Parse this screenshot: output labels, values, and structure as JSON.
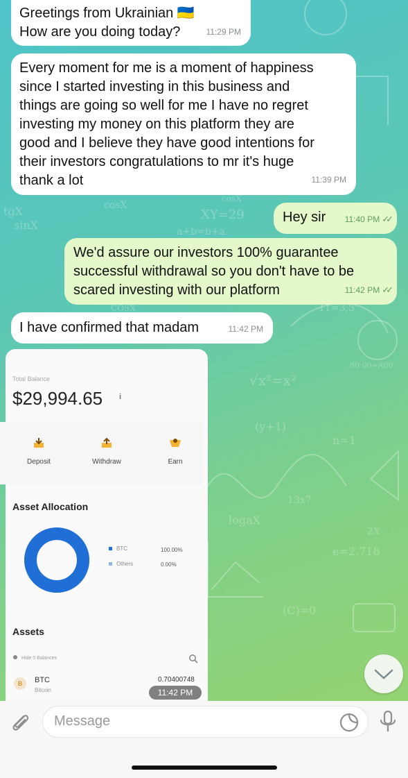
{
  "chat": {
    "messages": [
      {
        "direction": "in",
        "lines": "Greetings from Ukrainian 🇺🇦\nHow are you doing today?",
        "time": "11:29 PM"
      },
      {
        "direction": "in",
        "lines": "Every moment for me is a moment of happiness\nsince I started investing in this business and\nthings are going so well for me I have no regret\ninvesting my money on this platform they are\ngood and I believe they have good intentions for\ntheir investors congratulations to mr it's huge\nthank a lot",
        "time": "11:39 PM"
      },
      {
        "direction": "out",
        "lines": "Hey sir",
        "time": "11:40 PM",
        "ticks": "✓✓"
      },
      {
        "direction": "out",
        "lines": "We'd assure our investors 100% guarantee\nsuccessful withdrawal so you don't have to be\nscared investing with our platform",
        "time": "11:42 PM",
        "ticks": "✓✓"
      },
      {
        "direction": "in",
        "lines": "I have confirmed that madam",
        "time": "11:42 PM"
      }
    ],
    "image": {
      "time": "11:42 PM",
      "total_balance_label": "Total Balance",
      "balance": "$29,994.65",
      "balance_info": "i",
      "actions": [
        {
          "label": "Deposit"
        },
        {
          "label": "Withdraw"
        },
        {
          "label": "Earn"
        }
      ],
      "allocation_title": "Asset Allocation",
      "allocation": [
        {
          "name": "BTC",
          "percent": "100.00%",
          "color": "#1f6fd6"
        },
        {
          "name": "Others",
          "percent": "0.00%",
          "color": "#8fb4e6"
        }
      ],
      "donut_share": 1.0,
      "assets_title": "Assets",
      "hide_zero": "Hide 0 Balances",
      "asset_rows": [
        {
          "symbol": "BTC",
          "name": "Bitcoin",
          "amount": "0.70400748",
          "icon": "B"
        }
      ]
    }
  },
  "composer": {
    "placeholder": "Message",
    "attach_icon": "paperclip-icon",
    "sticker_icon": "sticker-icon",
    "mic_icon": "microphone-icon"
  },
  "scroll_icon": "chevron-down-icon",
  "background_doodles": [
    "sinX",
    "cosX",
    "tgX",
    "XY=29",
    "a+b=b+a",
    "cosX",
    "COSX",
    "11=3,5",
    "13x7",
    "n=1",
    "(y+1)",
    "2X",
    "e=2,718",
    "logaX",
    "√x²=x²",
    "(C)=0",
    "80·00=A00"
  ],
  "colors": {
    "incoming": "#ffffff",
    "outgoing": "#e4f8c9",
    "ticks": "#5da05a",
    "donut": "#1f6fd6"
  }
}
